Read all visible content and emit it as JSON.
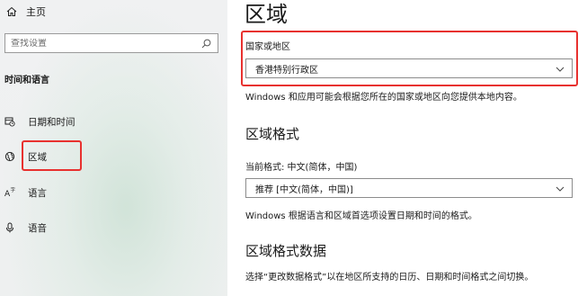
{
  "sidebar": {
    "home_label": "主页",
    "search_placeholder": "查找设置",
    "section_title": "时间和语言",
    "items": [
      {
        "label": "日期和时间",
        "icon": "calendar-clock-icon"
      },
      {
        "label": "区域",
        "icon": "globe-icon"
      },
      {
        "label": "语言",
        "icon": "language-icon"
      },
      {
        "label": "语音",
        "icon": "microphone-icon"
      }
    ]
  },
  "main": {
    "title": "区域",
    "country": {
      "label": "国家或地区",
      "selected": "香港特别行政区",
      "description": "Windows 和应用可能会根据您所在的国家或地区向您提供本地内容。"
    },
    "format": {
      "title": "区域格式",
      "current": "当前格式: 中文(简体，中国)",
      "selected": "推荐 [中文(简体，中国)]",
      "description": "Windows 根据语言和区域首选项设置日期和时间的格式。"
    },
    "format_data": {
      "title": "区域格式数据",
      "description": "选择“更改数据格式”以在地区所支持的日历、日期和时间格式之间切换。"
    }
  },
  "colors": {
    "highlight": "#e8312f",
    "sidebar_bg": "#f0f1f2"
  }
}
